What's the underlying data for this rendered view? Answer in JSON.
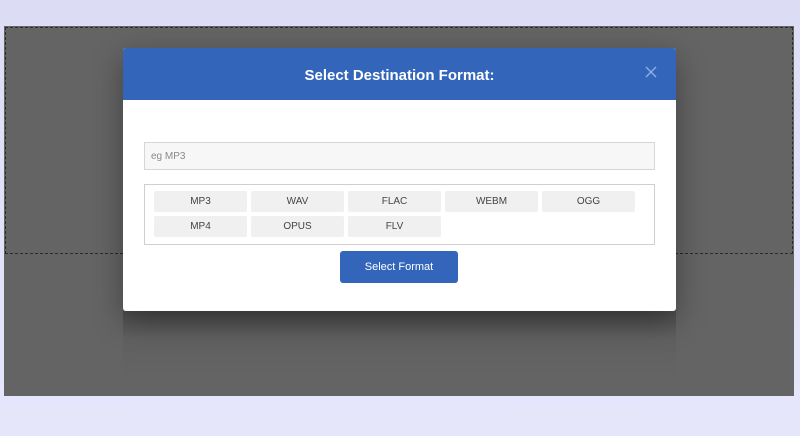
{
  "modal": {
    "title": "Select Destination Format:",
    "close_icon": "close-icon",
    "search_placeholder": "eg MP3",
    "search_value": "",
    "formats": [
      {
        "label": "MP3"
      },
      {
        "label": "WAV"
      },
      {
        "label": "FLAC"
      },
      {
        "label": "WEBM"
      },
      {
        "label": "OGG"
      },
      {
        "label": "MP4"
      },
      {
        "label": "OPUS"
      },
      {
        "label": "FLV"
      }
    ],
    "submit_label": "Select Format"
  },
  "colors": {
    "accent": "#3366bb",
    "overlay": "#646464",
    "background": "#e2e2fa"
  }
}
